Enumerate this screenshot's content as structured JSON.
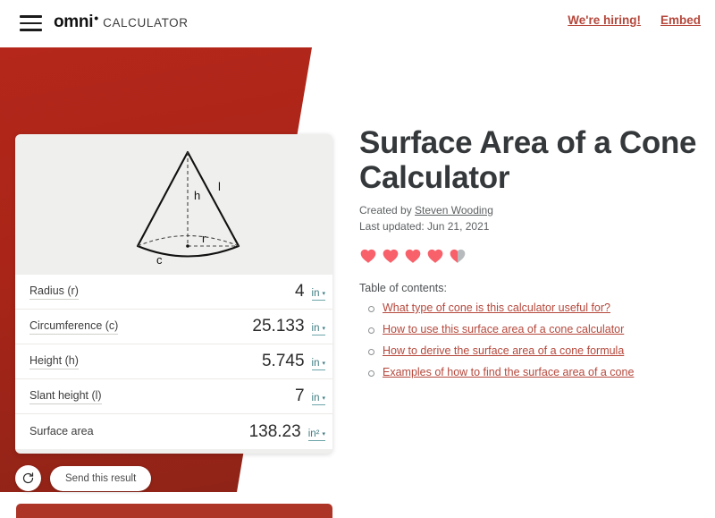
{
  "header": {
    "menu_icon": "hamburger-icon",
    "brand_name": "omni",
    "brand_dot": "•",
    "brand_suffix": "CALCULATOR",
    "links": [
      {
        "label": "We're hiring!"
      },
      {
        "label": "Embed"
      }
    ]
  },
  "calculator": {
    "diagram": {
      "name": "cone-diagram",
      "labels": {
        "height": "h",
        "slant": "l",
        "radius": "r",
        "circumference": "c"
      }
    },
    "rows": [
      {
        "label": "Radius (r)",
        "value": "4",
        "unit": "in",
        "caret": "▾"
      },
      {
        "label": "Circumference (c)",
        "value": "25.133",
        "unit": "in",
        "caret": "▾"
      },
      {
        "label": "Height (h)",
        "value": "5.745",
        "unit": "in",
        "caret": "▾"
      },
      {
        "label": "Slant height (l)",
        "value": "7",
        "unit": "in",
        "caret": "▾"
      },
      {
        "label": "Surface area",
        "value": "138.23",
        "unit": "in²",
        "caret": "▾"
      }
    ],
    "actions": {
      "reload_icon": "reload-icon",
      "send_label": "Send this result"
    }
  },
  "article": {
    "title": "Surface Area of a Cone Calculator",
    "created_by_prefix": "Created by ",
    "author": "Steven Wooding",
    "last_updated": "Last updated: Jun 21, 2021",
    "rating": {
      "filled": 4,
      "half": 1,
      "total": 5,
      "filled_color": "#f8606a",
      "empty_color": "#b8bbbd"
    },
    "toc_title": "Table of contents:",
    "toc": [
      {
        "label": "What type of cone is this calculator useful for?"
      },
      {
        "label": "How to use this surface area of a cone calculator"
      },
      {
        "label": "How to derive the surface area of a cone formula"
      },
      {
        "label": "Examples of how to find the surface area of a cone"
      }
    ]
  },
  "theme": {
    "brand_red": "#b4271a",
    "link_red": "#b5483c",
    "unit_teal": "#3f7c82",
    "card_bg": "#efefed"
  }
}
